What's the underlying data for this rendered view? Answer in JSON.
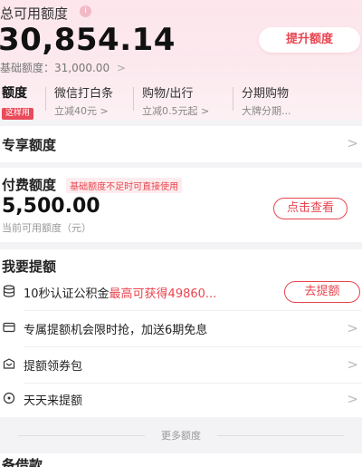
{
  "hero": {
    "title": "总可用额度",
    "info_icon": "i",
    "amount": "30,854.14",
    "base_label": "基础额度：31,000.00",
    "base_chevron": ">",
    "raise_button": "提升额度"
  },
  "pills": [
    {
      "title": "额度",
      "tag": "这样用"
    },
    {
      "title": "微信打白条",
      "sub": "立减40元",
      "chev": ">"
    },
    {
      "title": "购物/出行",
      "sub": "立减0.5元起",
      "chev": ">"
    },
    {
      "title": "分期购物",
      "sub": "大牌分期..."
    }
  ],
  "exclusive": {
    "title": "专享额度",
    "chevron": ">"
  },
  "paid": {
    "title": "付费额度",
    "tag": "基础额度不足时可直接使用",
    "amount": "5,500.00",
    "sub": "当前可用额度（元）",
    "button": "点击查看"
  },
  "raise": {
    "title": "我要提额",
    "items": [
      {
        "label": "10秒认证公积金",
        "highlight": "最高可获得49860...",
        "button": "去提额",
        "icon": "database-icon"
      },
      {
        "label": "专属提额机会限时抢，加送6期免息",
        "chevron": ">",
        "icon": "card-icon"
      },
      {
        "label": "提额领券包",
        "chevron": ">",
        "icon": "gift-icon"
      },
      {
        "label": "天天来提额",
        "chevron": ">",
        "icon": "coin-icon"
      }
    ]
  },
  "more": "更多额度",
  "bottom_peek": "备借款"
}
